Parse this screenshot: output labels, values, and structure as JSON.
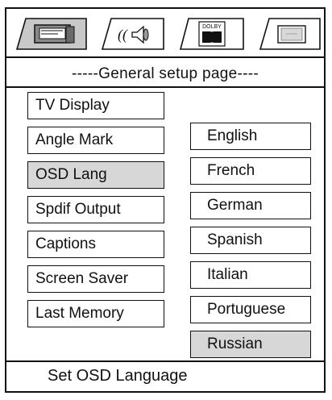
{
  "tabs": [
    {
      "name": "general-setup-tab",
      "icon": "general-setup-icon",
      "active": true
    },
    {
      "name": "audio-setup-tab",
      "icon": "audio-speaker-icon",
      "active": false
    },
    {
      "name": "dolby-setup-tab",
      "icon": "dolby-icon",
      "label": "DOLBY",
      "active": false
    },
    {
      "name": "video-setup-tab",
      "icon": "video-screen-icon",
      "active": false
    }
  ],
  "page_title": "-----General setup page----",
  "menu_items": [
    {
      "label": "TV Display",
      "selected": false
    },
    {
      "label": "Angle Mark",
      "selected": false
    },
    {
      "label": "OSD Lang",
      "selected": true
    },
    {
      "label": "Spdif Output",
      "selected": false
    },
    {
      "label": "Captions",
      "selected": false
    },
    {
      "label": "Screen Saver",
      "selected": false
    },
    {
      "label": "Last Memory",
      "selected": false
    }
  ],
  "options": [
    {
      "label": "English",
      "selected": false
    },
    {
      "label": "French",
      "selected": false
    },
    {
      "label": "German",
      "selected": false
    },
    {
      "label": "Spanish",
      "selected": false
    },
    {
      "label": "Italian",
      "selected": false
    },
    {
      "label": "Portuguese",
      "selected": false
    },
    {
      "label": "Russian",
      "selected": true
    }
  ],
  "status_text": "Set OSD Language",
  "colors": {
    "selected_bg": "#d7d7d7",
    "border": "#111111",
    "active_tab_bg": "#c8c8c8"
  }
}
